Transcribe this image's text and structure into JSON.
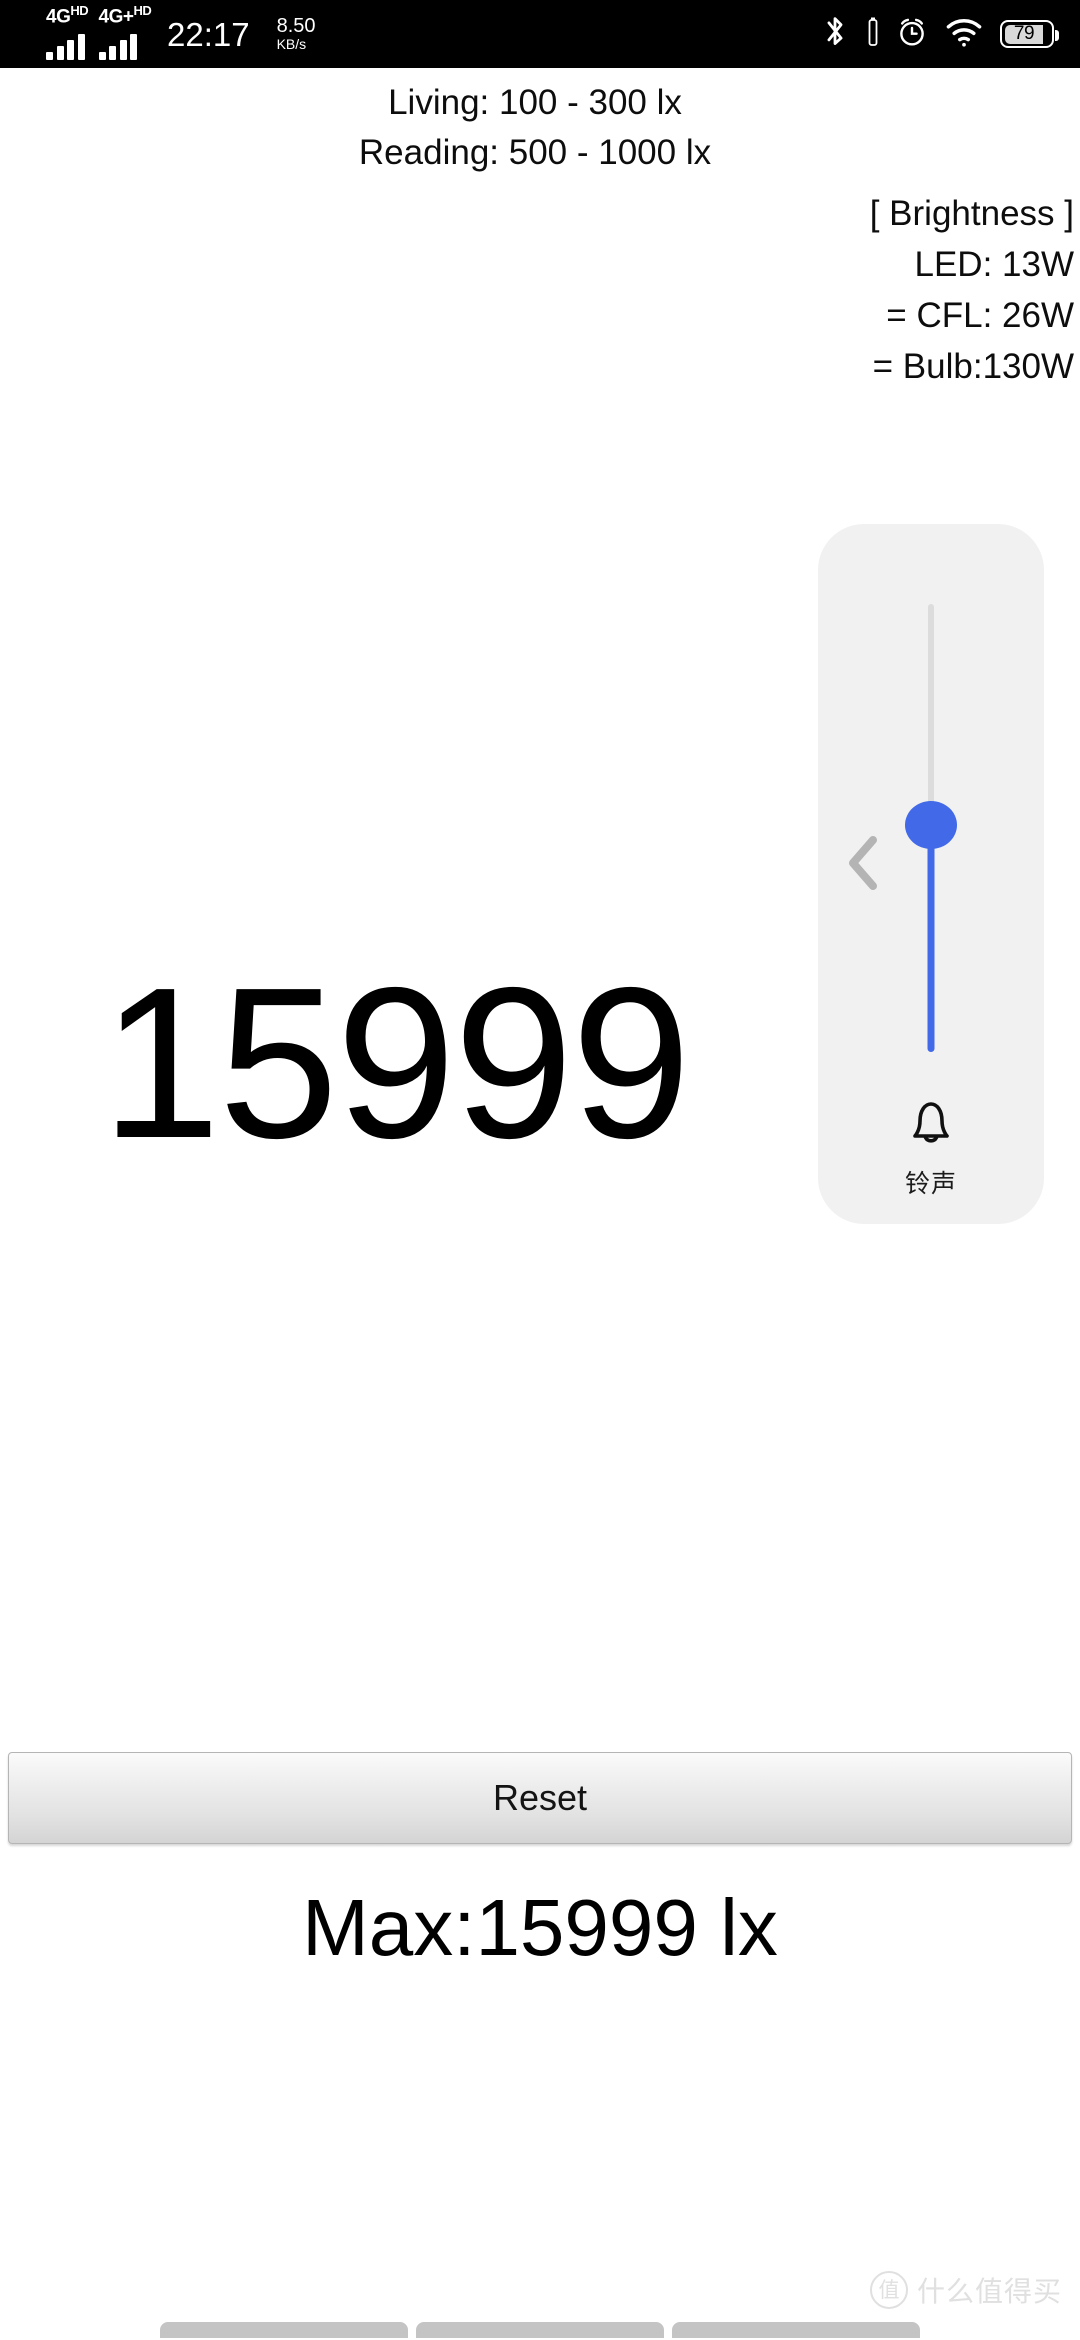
{
  "status_bar": {
    "sim1_network": "4G",
    "sim1_network_sup": "HD",
    "sim2_network": "4G+",
    "sim2_network_sup": "HD",
    "clock": "22:17",
    "net_speed_value": "8.50",
    "net_speed_unit": "KB/s",
    "icons": [
      "bluetooth-icon",
      "alarm-icon",
      "wifi-icon",
      "battery-icon"
    ],
    "battery_percent": "79"
  },
  "reference_levels": {
    "living": "Living: 100 - 300 lx",
    "reading": "Reading: 500 - 1000 lx"
  },
  "brightness": {
    "heading": "[ Brightness ]",
    "led": "LED: 13W",
    "cfl": "= CFL: 26W",
    "bulb": "= Bulb:130W"
  },
  "volume_panel": {
    "stream_label": "铃声",
    "collapse_icon": "chevron-left-icon",
    "stream_icon": "bell-icon",
    "slider_value_percent": 50,
    "accent_color": "#4169e8",
    "panel_color": "#f1f1f1",
    "track_color": "#dcdcdc"
  },
  "reading": {
    "lux_value": "15999",
    "max_label": "Max:15999 lx"
  },
  "actions": {
    "reset_label": "Reset"
  },
  "watermark": {
    "mark": "值",
    "text": "什么值得买"
  }
}
